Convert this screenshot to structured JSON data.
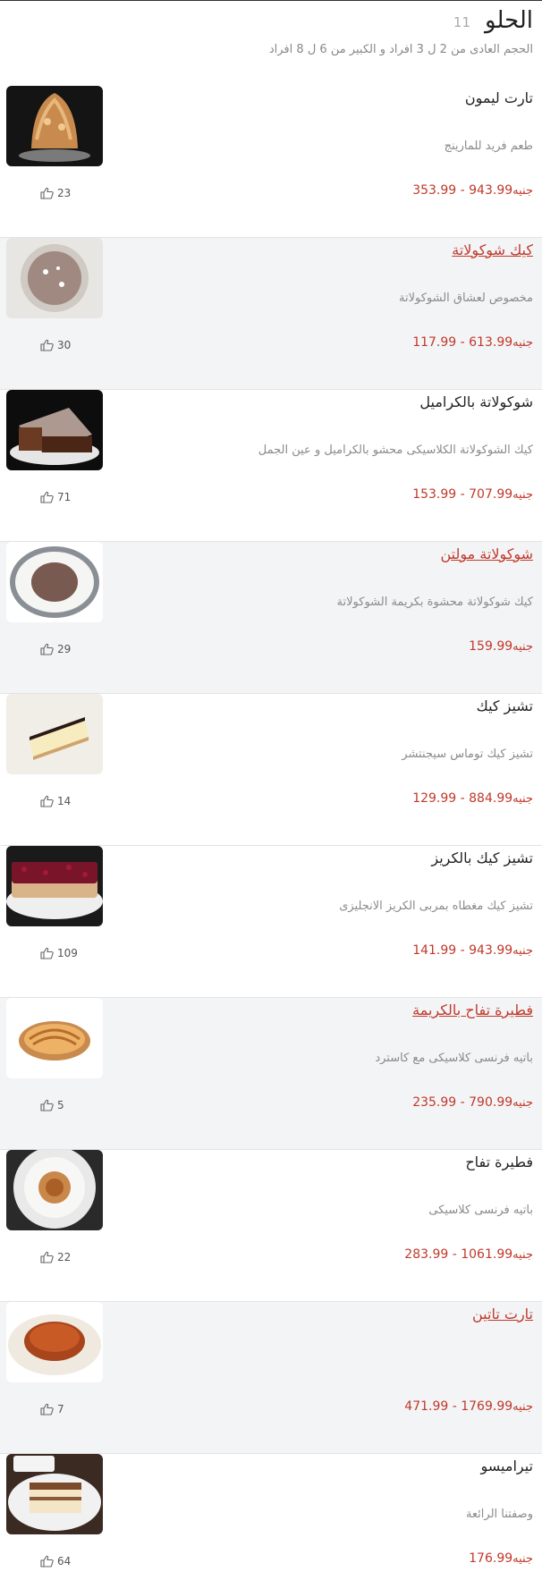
{
  "section": {
    "title": "الحلو",
    "count": "11",
    "subtitle": "الحجم العادى من 2 ل 3 افراد و الكبير من 6 ل 8 افراد"
  },
  "currency": "جنيه",
  "items": [
    {
      "name": "تارت ليمون",
      "desc": "طعم فريد للمارينج",
      "price": "353.99 - 943.99",
      "likes": "23",
      "link": false,
      "shaded": false,
      "image": "meringue-tart"
    },
    {
      "name": "كيك شوكولاتة",
      "desc": "مخصوص لعشاق الشوكولاتة",
      "price": "117.99 - 613.99",
      "likes": "30",
      "link": true,
      "shaded": true,
      "image": "chocolate-cake"
    },
    {
      "name": "شوكولاتة بالكراميل",
      "desc": "كيك الشوكولاتة الكلاسيكى محشو بالكراميل و عين الجمل",
      "price": "153.99 - 707.99",
      "likes": "71",
      "link": false,
      "shaded": false,
      "image": "caramel-cake"
    },
    {
      "name": "شوكولاتة مولتن",
      "desc": "كيك شوكولاتة محشوة بكريمة الشوكولاتة",
      "price": "159.99",
      "likes": "29",
      "link": true,
      "shaded": true,
      "image": "molten-cake"
    },
    {
      "name": "تشيز كيك",
      "desc": "تشيز كيك توماس سيجنتشر",
      "price": "129.99 - 884.99",
      "likes": "14",
      "link": false,
      "shaded": false,
      "image": "cheesecake"
    },
    {
      "name": "تشيز كيك بالكريز",
      "desc": "تشيز كيك مغطاه بمربى الكريز الانجليزى",
      "price": "141.99 - 943.99",
      "likes": "109",
      "link": false,
      "shaded": false,
      "image": "cherry-cheesecake"
    },
    {
      "name": "فطيرة تفاح بالكريمة",
      "desc": "باتيه فرنسى كلاسيكى مع كاسترد",
      "price": "235.99 - 790.99",
      "likes": "5",
      "link": true,
      "shaded": true,
      "image": "apple-cream-tart"
    },
    {
      "name": "فطيرة تفاح",
      "desc": "باتيه فرنسى كلاسيكى",
      "price": "283.99 - 1061.99",
      "likes": "22",
      "link": false,
      "shaded": false,
      "image": "apple-pie"
    },
    {
      "name": "تارت تاتين",
      "desc": "",
      "price": "471.99 - 1769.99",
      "likes": "7",
      "link": true,
      "shaded": true,
      "image": "tarte-tatin"
    },
    {
      "name": "تيراميسو",
      "desc": "وصفتنا الرائعة",
      "price": "176.99",
      "likes": "64",
      "link": false,
      "shaded": false,
      "image": "tiramisu"
    }
  ]
}
